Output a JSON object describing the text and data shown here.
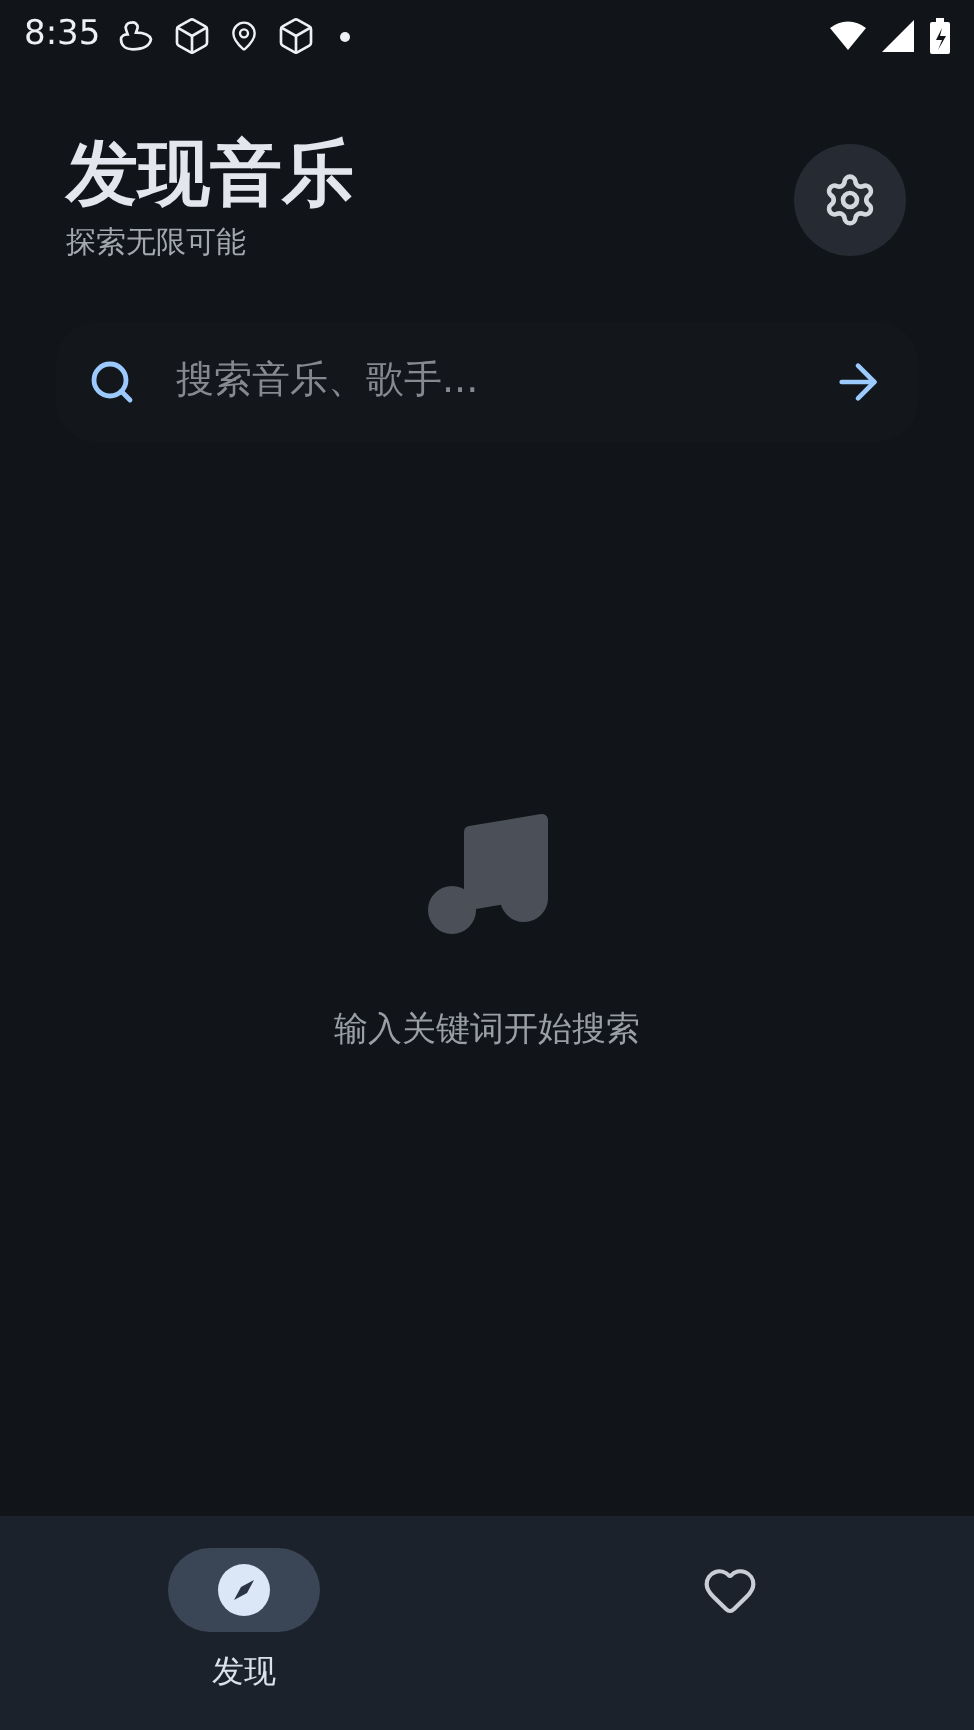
{
  "status_bar": {
    "time": "8:35"
  },
  "header": {
    "title": "发现音乐",
    "subtitle": "探索无限可能"
  },
  "search": {
    "placeholder": "搜索音乐、歌手..."
  },
  "empty_state": {
    "message": "输入关键词开始搜索"
  },
  "bottom_nav": [
    {
      "kind": "discover",
      "label": "发现",
      "selected": true
    },
    {
      "kind": "favorites",
      "selected": false
    }
  ]
}
